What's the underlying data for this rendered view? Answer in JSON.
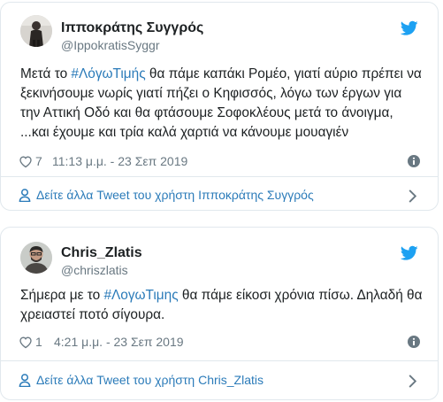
{
  "tweets": [
    {
      "author_name": "Ιπποκράτης Συγγρός",
      "handle": "@IppokratisSyggr",
      "text_before": "Μετά το ",
      "hashtag": "#ΛόγωΤιμής",
      "text_after": " θα πάμε καπάκι Ρομέο, γιατί αύριο πρέπει να ξεκινήσουμε νωρίς γιατί πήζει ο Κηφισσός, λόγω των έργων για την Αττική Οδό και θα φτάσουμε Σοφοκλέους μετά το άνοιγμα, ...και έχουμε και τρία καλά χαρτιά να κάνουμε μουαγιέν",
      "likes": "7",
      "timestamp": "11:13 μ.μ. - 23 Σεπ 2019",
      "more_label": "Δείτε άλλα Tweet του χρήστη Ιπποκράτης Συγγρός"
    },
    {
      "author_name": "Chris_Zlatis",
      "handle": "@chriszlatis",
      "text_before": "Σήμερα με το ",
      "hashtag": "#ΛογωΤιμης",
      "text_after": " θα πάμε είκοσι χρόνια πίσω. Δηλαδή θα χρειαστεί ποτό σίγουρα.",
      "likes": "1",
      "timestamp": "4:21 μ.μ. - 23 Σεπ 2019",
      "more_label": "Δείτε άλλα Tweet του χρήστη Chris_Zlatis"
    }
  ],
  "colors": {
    "link": "#2b7bb9",
    "meta": "#697882",
    "border": "#e1e8ed",
    "twitter_blue": "#1da1f2"
  },
  "icons": [
    "twitter-bird-icon",
    "heart-icon",
    "info-icon",
    "person-icon",
    "chevron-right-icon"
  ]
}
